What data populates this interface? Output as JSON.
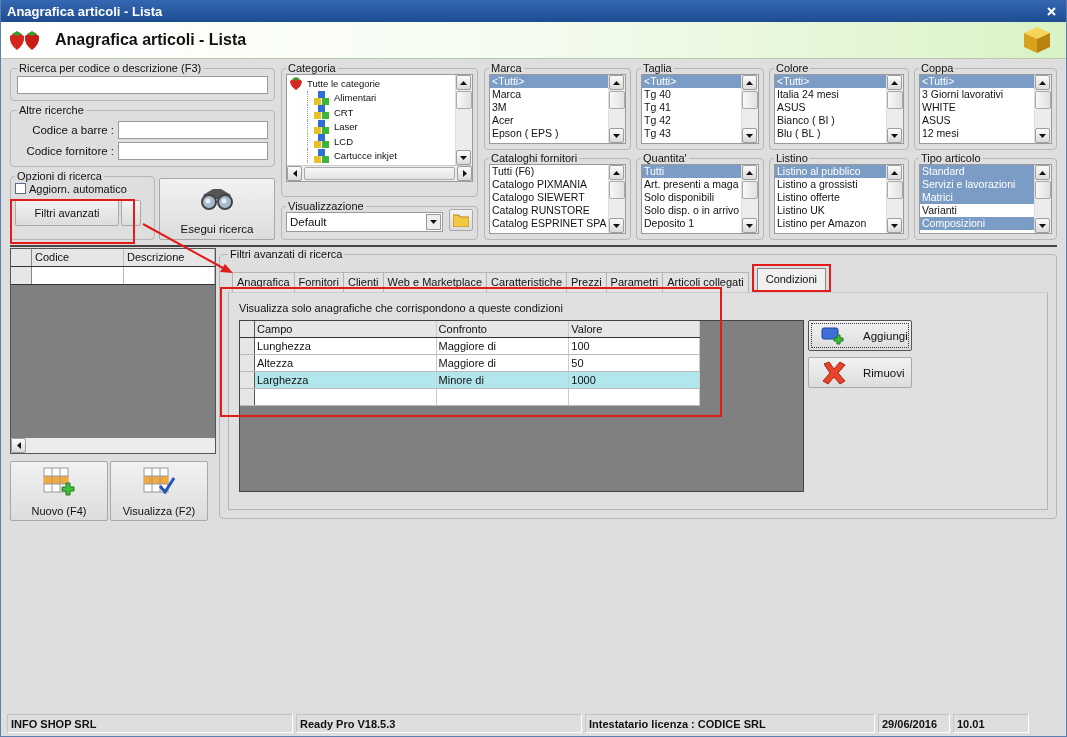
{
  "window": {
    "title": "Anagrafica articoli  - Lista"
  },
  "header": {
    "title": "Anagrafica articoli  - Lista"
  },
  "search": {
    "title": "Ricerca per codice o descrizione (F3)"
  },
  "other_searches": {
    "title": "Altre ricerche",
    "fields": [
      {
        "label": "Codice a barre :"
      },
      {
        "label": "Codice fornitore :"
      }
    ]
  },
  "search_options": {
    "title": "Opzioni di ricerca",
    "auto_update": {
      "label": "Aggiorn. automatico",
      "checked": false
    },
    "advanced_button": "Filtri avanzati"
  },
  "run_search_button": "Esegui ricerca",
  "category": {
    "title": "Categoria",
    "tree": {
      "label": "Tutte le categorie",
      "children": [
        {
          "label": "Alimentari"
        },
        {
          "label": "CRT"
        },
        {
          "label": "Laser"
        },
        {
          "label": "LCD"
        },
        {
          "label": "Cartucce inkjet"
        }
      ]
    }
  },
  "view": {
    "title": "Visualizzazione",
    "value": "Default"
  },
  "lists": [
    {
      "title": "Marca",
      "items": [
        {
          "label": "<Tutti>",
          "selected": true
        },
        {
          "label": "Marca",
          "selected": false
        },
        {
          "label": "3M",
          "selected": false
        },
        {
          "label": "Acer",
          "selected": false
        },
        {
          "label": "Epson ( EPS )",
          "selected": false
        }
      ]
    },
    {
      "title": "Taglia",
      "items": [
        {
          "label": "<Tutti>",
          "selected": true
        },
        {
          "label": "Tg 40",
          "selected": false
        },
        {
          "label": "Tg 41",
          "selected": false
        },
        {
          "label": "Tg 42",
          "selected": false
        },
        {
          "label": "Tg 43",
          "selected": false
        }
      ]
    },
    {
      "title": "Colore",
      "items": [
        {
          "label": "<Tutti>",
          "selected": true
        },
        {
          "label": "Italia 24 mesi",
          "selected": false
        },
        {
          "label": "ASUS",
          "selected": false
        },
        {
          "label": "Bianco ( BI )",
          "selected": false
        },
        {
          "label": "Blu ( BL )",
          "selected": false
        }
      ]
    },
    {
      "title": "Coppa",
      "items": [
        {
          "label": "<Tutti>",
          "selected": true
        },
        {
          "label": "3 Giorni lavorativi",
          "selected": false
        },
        {
          "label": "WHITE",
          "selected": false
        },
        {
          "label": "ASUS",
          "selected": false
        },
        {
          "label": "12 mesi",
          "selected": false
        }
      ]
    },
    {
      "title": "Cataloghi fornitori",
      "items": [
        {
          "label": "Tutti (F6)",
          "selected": false
        },
        {
          "label": "Catalogo PIXMANIA",
          "selected": false
        },
        {
          "label": "Catalogo SIEWERT",
          "selected": false
        },
        {
          "label": "Catalog RUNSTORE",
          "selected": false
        },
        {
          "label": "Catalog ESPRINET SPA",
          "selected": false
        }
      ]
    },
    {
      "title": "Quantita'",
      "items": [
        {
          "label": "Tutti",
          "selected": true
        },
        {
          "label": "Art. presenti a maga",
          "selected": false
        },
        {
          "label": "Solo disponibili",
          "selected": false
        },
        {
          "label": "Solo disp. o in arrivo",
          "selected": false
        },
        {
          "label": "Deposito 1",
          "selected": false
        }
      ]
    },
    {
      "title": "Listino",
      "items": [
        {
          "label": "Listino al pubblico",
          "selected": true
        },
        {
          "label": "Listino a grossisti",
          "selected": false
        },
        {
          "label": "Listino offerte",
          "selected": false
        },
        {
          "label": "Listino UK",
          "selected": false
        },
        {
          "label": "Listino per Amazon",
          "selected": false
        }
      ]
    },
    {
      "title": "Tipo articolo",
      "items": [
        {
          "label": "Standard",
          "selected": true
        },
        {
          "label": "Servizi e lavorazioni",
          "selected": true
        },
        {
          "label": "Matrici",
          "selected": true
        },
        {
          "label": "Varianti",
          "selected": false
        },
        {
          "label": "Composizioni",
          "selected": true
        }
      ]
    }
  ],
  "results_grid": {
    "columns": [
      "Codice",
      "Descrizione"
    ]
  },
  "buttons": [
    {
      "label": "Nuovo (F4)",
      "kind": "new"
    },
    {
      "label": "Visualizza (F2)",
      "kind": "view"
    }
  ],
  "advanced_filters": {
    "title": "Filtri avanzati di ricerca",
    "tabs": [
      {
        "label": "Anagrafica",
        "selected": false
      },
      {
        "label": "Fornitori",
        "selected": false
      },
      {
        "label": "Clienti",
        "selected": false
      },
      {
        "label": "Web e Marketplace",
        "selected": false
      },
      {
        "label": "Caratteristiche",
        "selected": false
      },
      {
        "label": "Prezzi",
        "selected": false
      },
      {
        "label": "Parametri",
        "selected": false
      },
      {
        "label": "Articoli collegati",
        "selected": false
      },
      {
        "label": "Condizioni",
        "selected": true
      }
    ],
    "description": "Visualizza solo anagrafiche che corrispondono a queste condizioni",
    "table": {
      "columns": [
        "Campo",
        "Confronto",
        "Valore"
      ],
      "rows": [
        {
          "cells": [
            "Lunghezza",
            "Maggiore di",
            "100"
          ],
          "selected": false
        },
        {
          "cells": [
            "Altezza",
            "Maggiore di",
            "50"
          ],
          "selected": false
        },
        {
          "cells": [
            "Larghezza",
            "Minore di",
            "1000"
          ],
          "selected": true
        }
      ]
    },
    "actions": [
      {
        "label": "Aggiungi",
        "kind": "add"
      },
      {
        "label": "Rimuovi",
        "kind": "remove"
      }
    ]
  },
  "status_bar": [
    "INFO SHOP SRL",
    "Ready Pro V18.5.3",
    "Intestatario licenza : CODICE SRL",
    "29/06/2016",
    "10.01"
  ]
}
